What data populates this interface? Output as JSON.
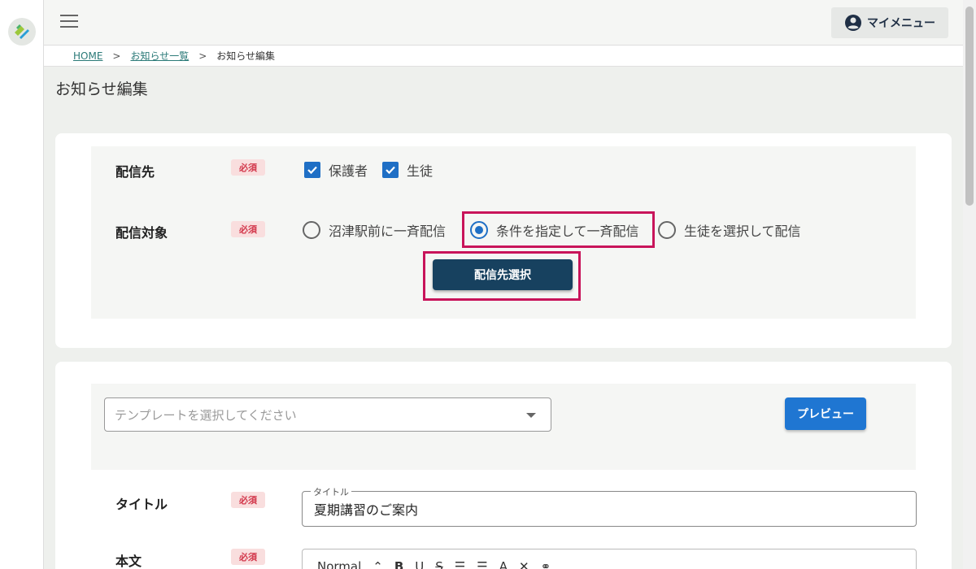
{
  "header": {
    "menu_label": "マイメニュー"
  },
  "breadcrumb": {
    "home": "HOME",
    "list": "お知らせ一覧",
    "current": "お知らせ編集",
    "sep": ">"
  },
  "page": {
    "title": "お知らせ編集"
  },
  "delivery": {
    "dest_label": "配信先",
    "required": "必須",
    "checkboxes": [
      "保護者",
      "生徒"
    ],
    "target_label": "配信対象",
    "radios": [
      "沼津駅前に一斉配信",
      "条件を指定して一斉配信",
      "生徒を選択して配信"
    ],
    "selected_radio": 1,
    "select_button": "配信先選択"
  },
  "content": {
    "template_placeholder": "テンプレートを選択してください",
    "preview_button": "プレビュー",
    "title_label": "タイトル",
    "title_legend": "タイトル",
    "title_value": "夏期講習のご案内",
    "body_label": "本文",
    "toolbar": {
      "format": "Normal",
      "bold": "B",
      "underline": "U",
      "strike": "S"
    }
  },
  "colors": {
    "accent": "#1f6fc5",
    "dark_button": "#17415f",
    "highlight": "#c8145a",
    "required_bg": "#f9dede"
  }
}
